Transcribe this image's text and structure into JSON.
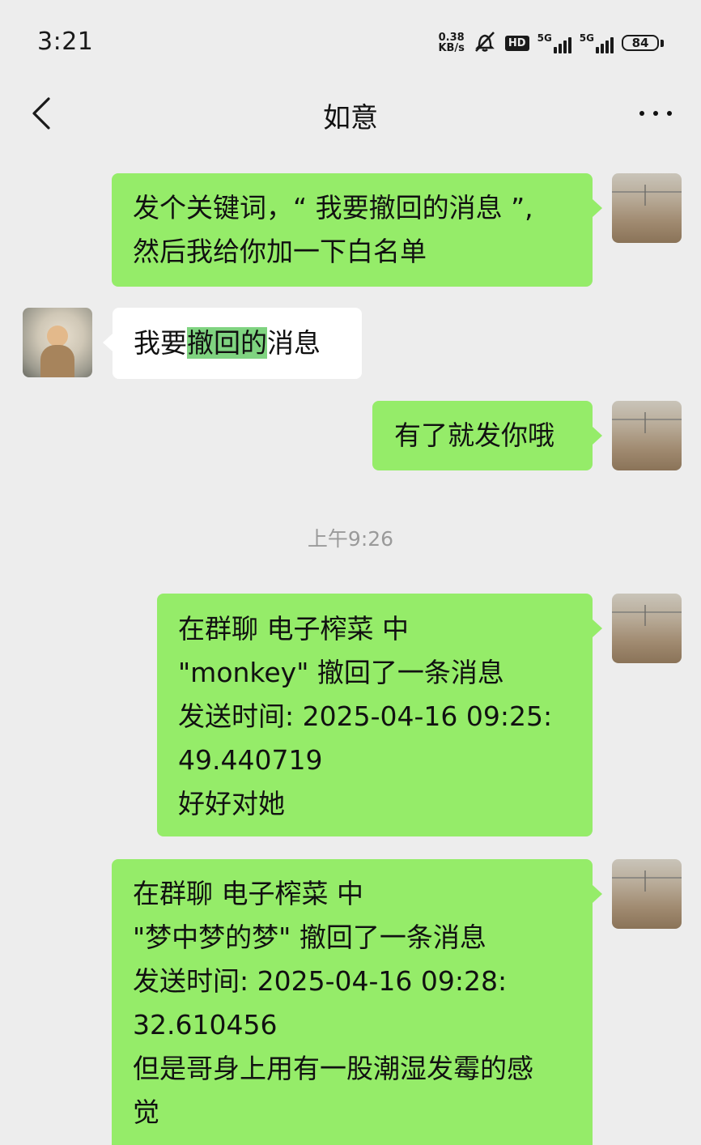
{
  "status_bar": {
    "time": "3:21",
    "net_speed_value": "0.38",
    "net_speed_unit": "KB/s",
    "hd_label": "HD",
    "sim1_label": "5G",
    "sim2_label": "5G",
    "battery_level": "84"
  },
  "nav": {
    "title": "如意"
  },
  "messages": [
    {
      "direction": "out",
      "text": "发个关键词，“ 我要撤回的消息 ”,\n然后我给你加一下白名单"
    },
    {
      "direction": "in",
      "text_before": "我要",
      "text_highlight": "撤回的",
      "text_after": "消息"
    },
    {
      "direction": "out",
      "text": "有了就发你哦"
    },
    {
      "direction": "out",
      "text": "在群聊 电子榨菜 中\n\"monkey\" 撤回了一条消息\n发送时间: 2025-04-16 09:25:\n49.440719\n好好对她"
    },
    {
      "direction": "out",
      "text": "在群聊 电子榨菜 中\n\"梦中梦的梦\" 撤回了一条消息\n发送时间: 2025-04-16 09:28:\n32.610456\n但是哥身上用有一股潮湿发霉的感\n觉"
    }
  ],
  "timestamp": "上午9:26",
  "colors": {
    "background": "#ededed",
    "outgoing_bubble": "#95ec69",
    "incoming_bubble": "#ffffff",
    "highlight": "#7fd380"
  }
}
